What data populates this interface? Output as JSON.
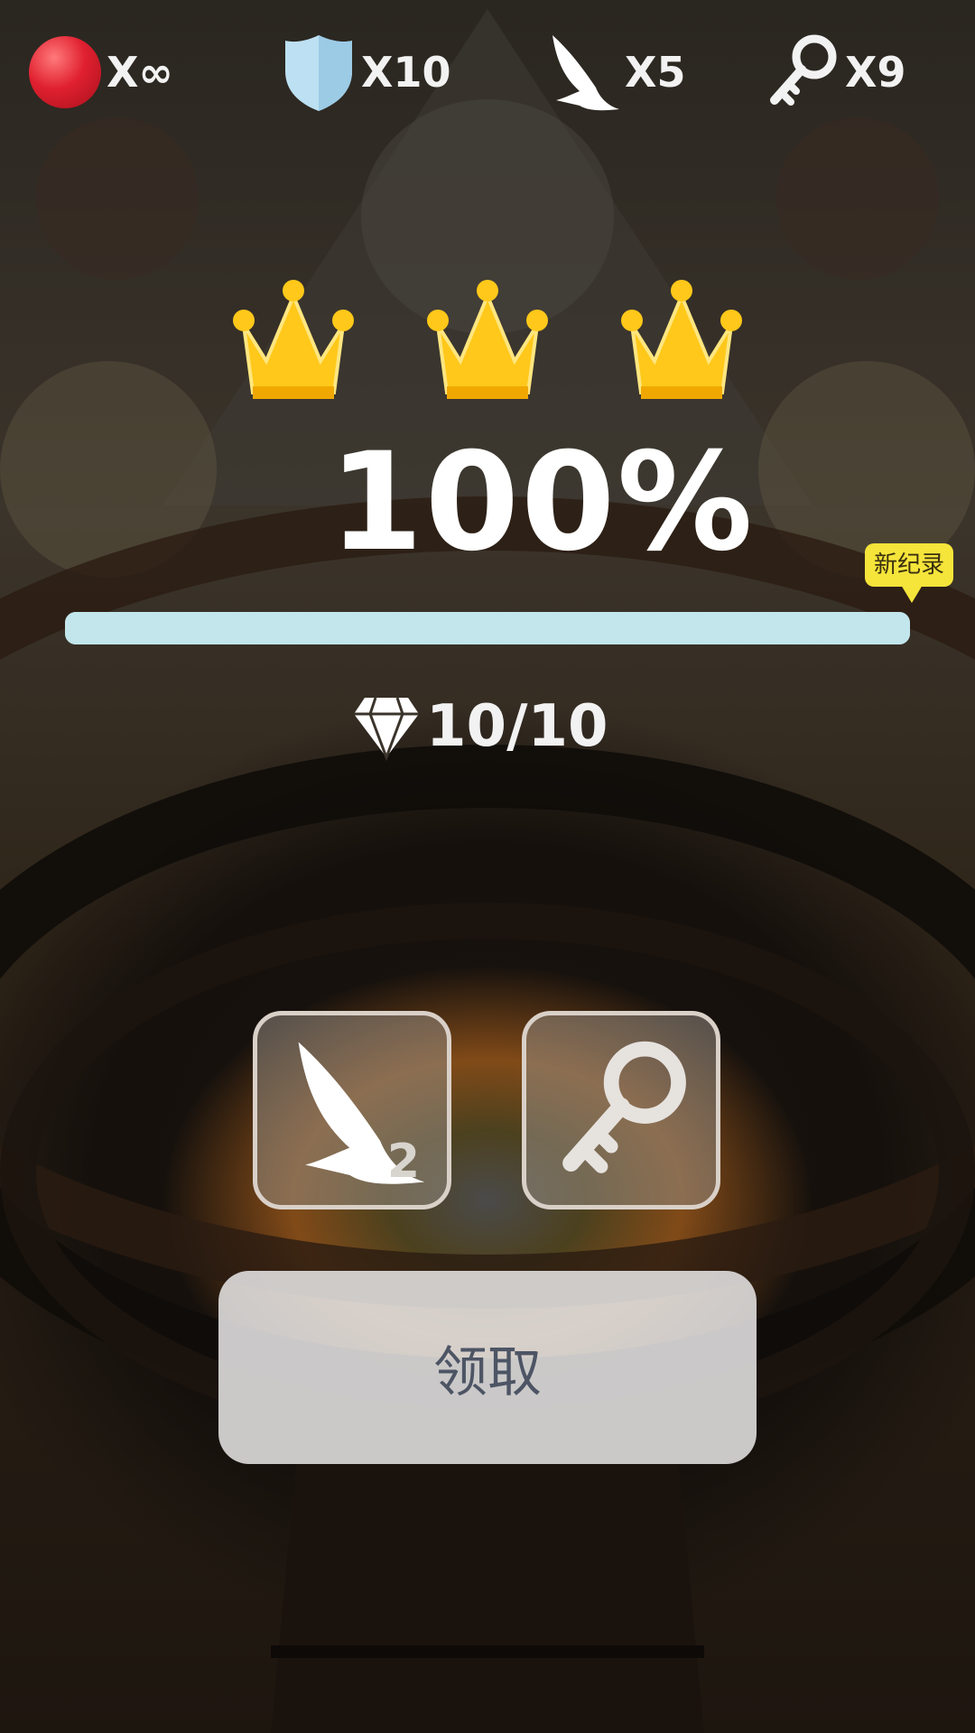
{
  "top_bar": {
    "lives": {
      "icon": "red-ball-icon",
      "count": "X∞"
    },
    "shields": {
      "icon": "shield-icon",
      "count": "X10"
    },
    "wings": {
      "icon": "wing-icon",
      "count": "X5"
    },
    "keys": {
      "icon": "key-icon",
      "count": "X9"
    }
  },
  "result": {
    "crowns_earned": 3,
    "crowns_total": 3,
    "percent": "100%",
    "progress": 1.0,
    "new_record_badge": "新纪录"
  },
  "gems": {
    "icon": "diamond-icon",
    "count": "10/10"
  },
  "rewards": [
    {
      "icon": "wing-icon",
      "count": "2"
    },
    {
      "icon": "key-icon",
      "count": ""
    }
  ],
  "claim_button_label": "领取",
  "colors": {
    "crown": "#ffc81a",
    "progress": "#c2e6ec",
    "badge": "#f5e43a",
    "ball": "#e02030"
  }
}
